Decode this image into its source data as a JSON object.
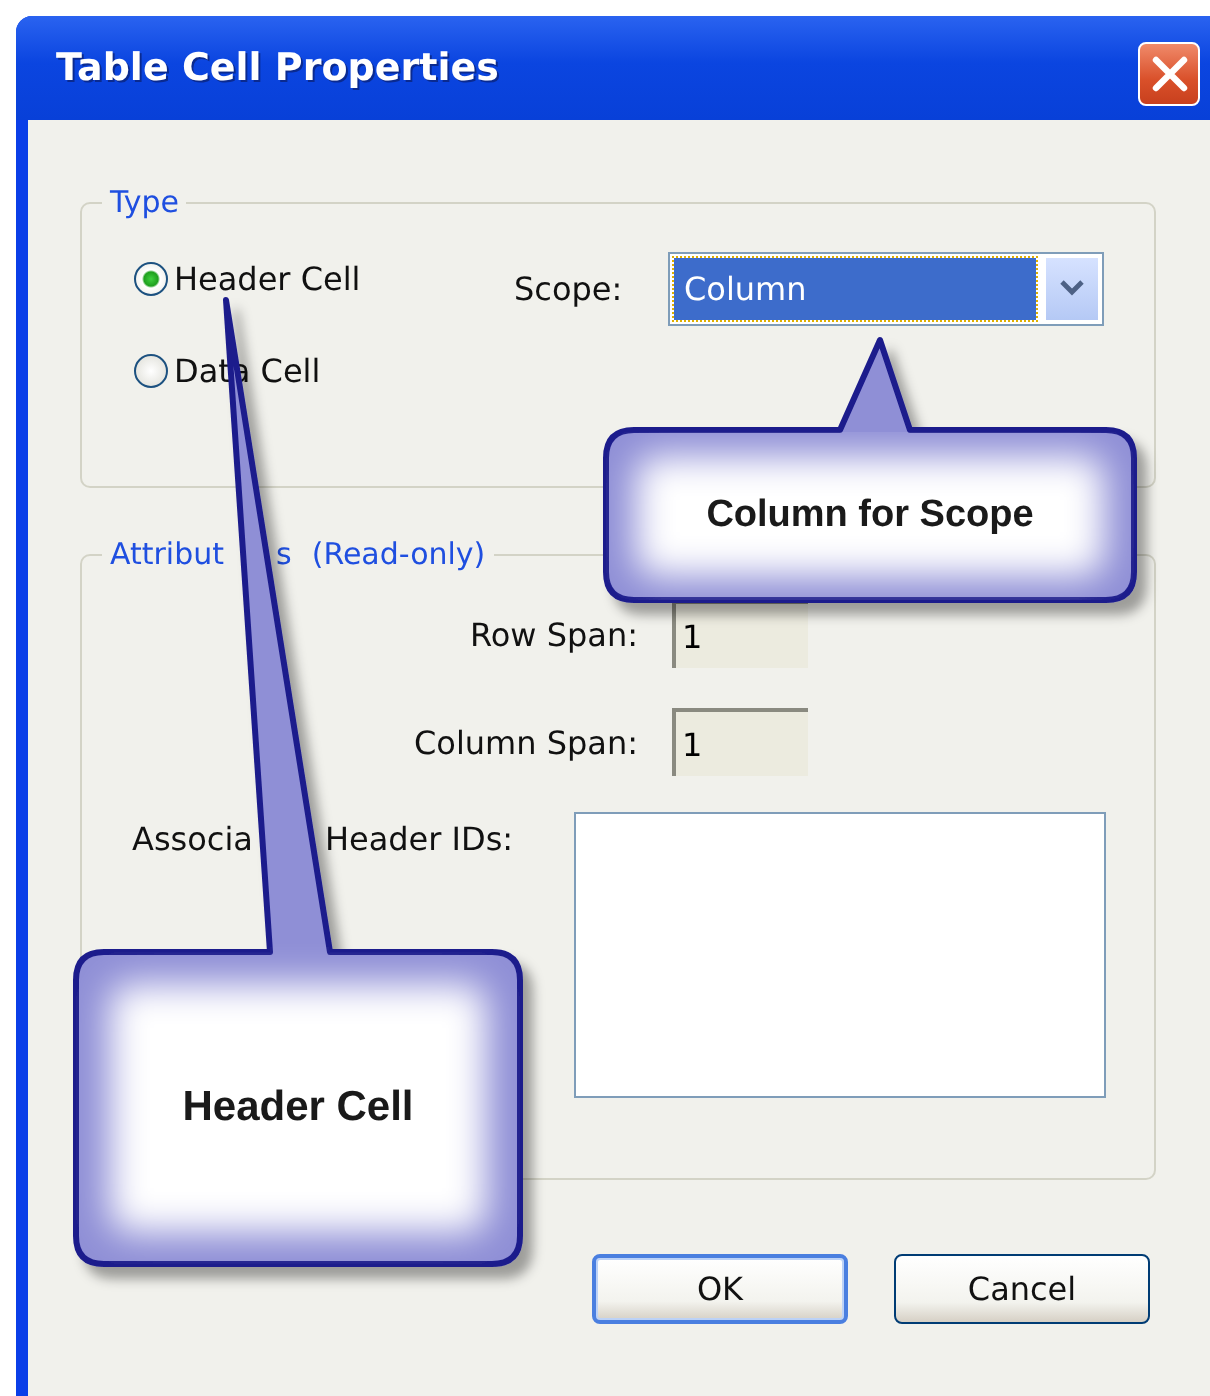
{
  "window": {
    "title": "Table Cell Properties"
  },
  "type_group": {
    "legend": "Type",
    "options": [
      {
        "label": "Header Cell",
        "selected": true
      },
      {
        "label": "Data Cell",
        "selected": false
      }
    ],
    "scope": {
      "label": "Scope:",
      "value": "Column"
    }
  },
  "attributes_group": {
    "legend_parts": [
      "Attribut",
      "s",
      "(Read-only)"
    ],
    "fields": [
      {
        "label": "Row Span:",
        "value": "1"
      },
      {
        "label": "Column Span:",
        "value": "1"
      }
    ],
    "header_ids": {
      "label_parts": [
        "Associa",
        "Header IDs:"
      ]
    }
  },
  "buttons": [
    {
      "label": "OK",
      "default": true
    },
    {
      "label": "Cancel",
      "default": false
    }
  ],
  "callouts": [
    {
      "text": "Column for Scope"
    },
    {
      "text": "Header Cell"
    }
  ]
}
